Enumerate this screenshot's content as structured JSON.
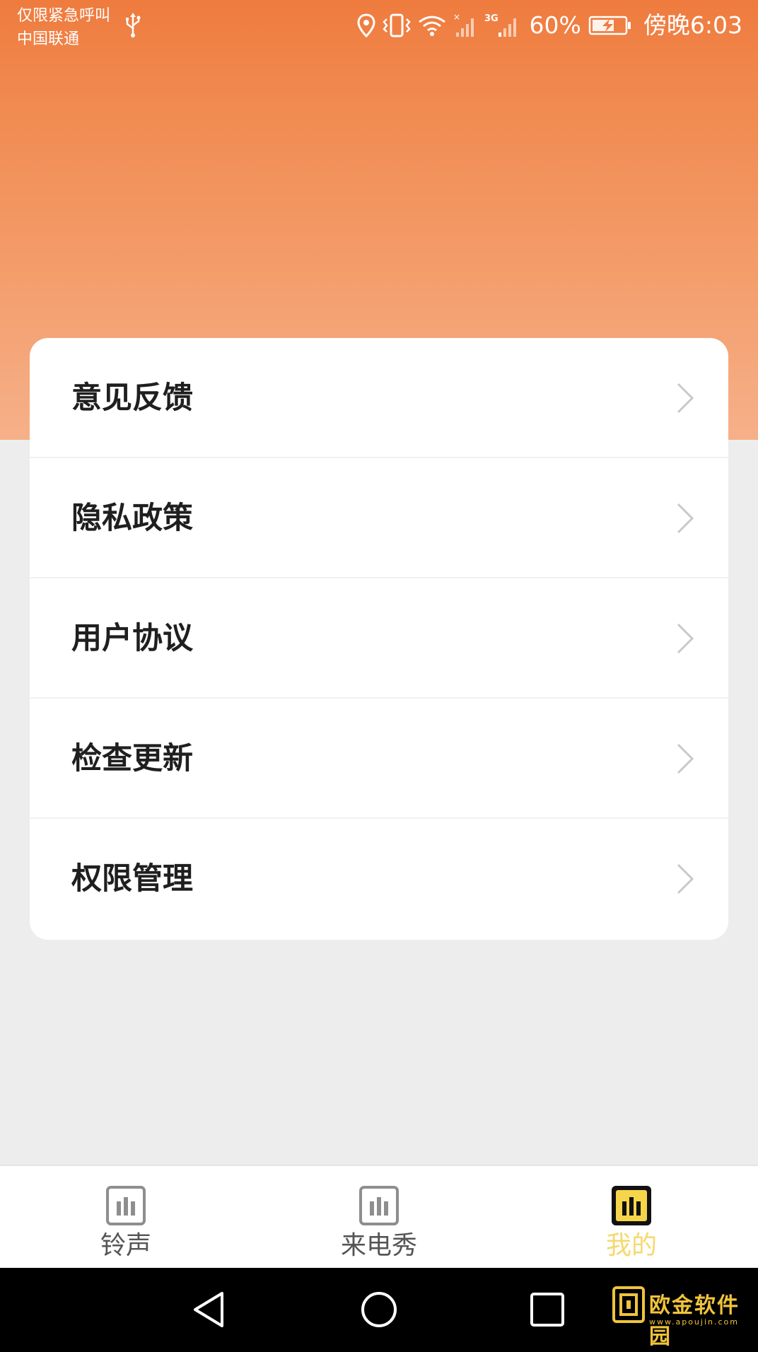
{
  "status_bar": {
    "carrier_line1": "仅限紧急呼叫",
    "carrier_line2": "中国联通",
    "network_label": "3G",
    "battery_percent": "60%",
    "time": "傍晚6:03",
    "icons": [
      "usb-icon",
      "location-icon",
      "vibrate-icon",
      "wifi-icon",
      "signal-icon",
      "signal-3g-icon",
      "battery-charging-icon"
    ]
  },
  "header": {
    "gradient_top": "#ef7b3e",
    "gradient_bottom": "#f6b089"
  },
  "menu": {
    "items": [
      {
        "label": "意见反馈",
        "icon": "chevron-right-icon"
      },
      {
        "label": "隐私政策",
        "icon": "chevron-right-icon"
      },
      {
        "label": "用户协议",
        "icon": "chevron-right-icon"
      },
      {
        "label": "检查更新",
        "icon": "chevron-right-icon"
      },
      {
        "label": "权限管理",
        "icon": "chevron-right-icon"
      }
    ]
  },
  "bottom_nav": {
    "tabs": [
      {
        "label": "铃声",
        "icon": "bar-chart-icon",
        "active": false
      },
      {
        "label": "来电秀",
        "icon": "bar-chart-icon",
        "active": false
      },
      {
        "label": "我的",
        "icon": "bar-chart-icon",
        "active": true
      }
    ],
    "active_color": "#f5d96f",
    "inactive_color": "#555555"
  },
  "system_nav": {
    "buttons": [
      "back-icon",
      "home-icon",
      "recents-icon"
    ]
  },
  "watermark": {
    "text": "欧金软件园",
    "url": "www.apoujin.com",
    "color": "#f0c33b"
  }
}
